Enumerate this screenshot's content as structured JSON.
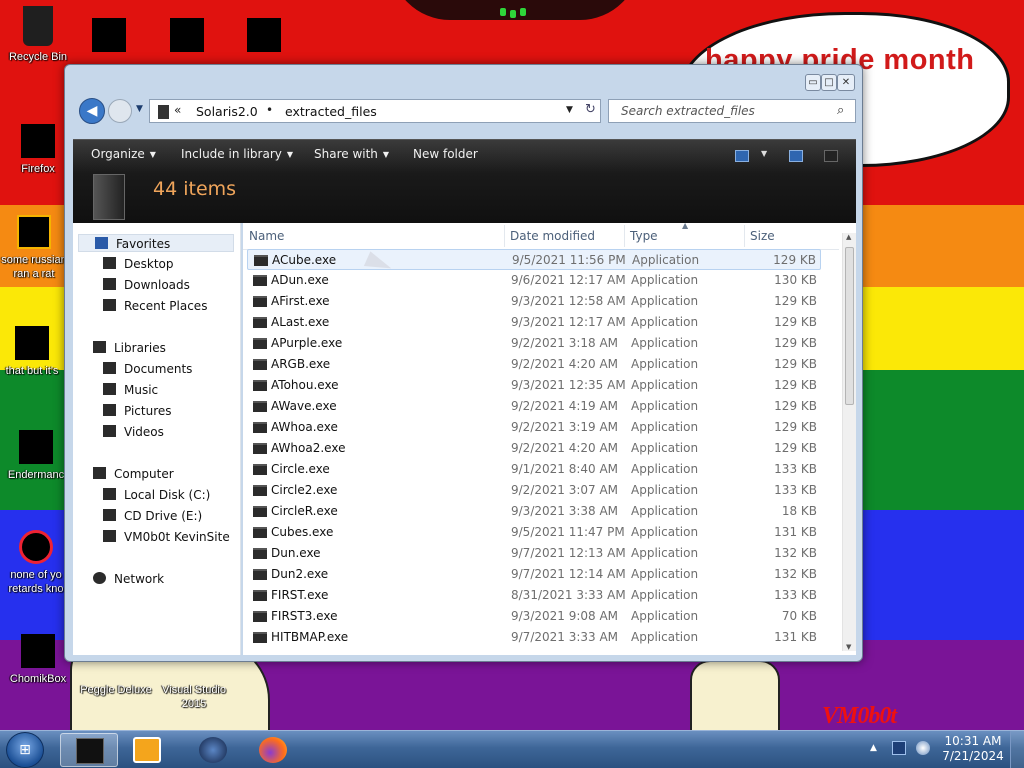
{
  "desktop": {
    "bubble_text": "happy pride month",
    "signature": "VM0b0t",
    "icons": [
      {
        "label": "Recycle Bin"
      },
      {
        "label": "Firefox"
      },
      {
        "label": "some russian ran a rat"
      },
      {
        "label": "that but it's"
      },
      {
        "label": "Endermanc"
      },
      {
        "label": "none of yo retards kno"
      },
      {
        "label": "ChomikBox"
      },
      {
        "label": "Peggle Deluxe"
      },
      {
        "label": "Visual Studio 2015"
      }
    ]
  },
  "window": {
    "controls": {
      "minimize": "▭",
      "maximize": "□",
      "close": "✕"
    },
    "address": {
      "chevron": "«",
      "crumbs": [
        "Solaris2.0",
        "extracted_files"
      ],
      "separator": "•",
      "dropdown": "▼",
      "refresh": "↻"
    },
    "search": {
      "placeholder": "Search extracted_files",
      "icon": "⌕"
    },
    "toolbar": {
      "organize": "Organize",
      "include_in_library": "Include in library",
      "share_with": "Share with",
      "new_folder": "New folder",
      "caret": "▼"
    },
    "item_count": "44 items",
    "nav": {
      "favorites": "Favorites",
      "desktop": "Desktop",
      "downloads": "Downloads",
      "recent_places": "Recent Places",
      "libraries": "Libraries",
      "documents": "Documents",
      "music": "Music",
      "pictures": "Pictures",
      "videos": "Videos",
      "computer": "Computer",
      "local_disk": "Local Disk (C:)",
      "cd_drive": "CD Drive (E:)",
      "vm0b0t": "VM0b0t KevinSite",
      "network": "Network"
    },
    "columns": {
      "name": "Name",
      "date": "Date modified",
      "type": "Type",
      "size": "Size"
    },
    "files": [
      {
        "name": "ACube.exe",
        "date": "9/5/2021 11:56 PM",
        "type": "Application",
        "size": "129 KB"
      },
      {
        "name": "ADun.exe",
        "date": "9/6/2021 12:17 AM",
        "type": "Application",
        "size": "130 KB"
      },
      {
        "name": "AFirst.exe",
        "date": "9/3/2021 12:58 AM",
        "type": "Application",
        "size": "129 KB"
      },
      {
        "name": "ALast.exe",
        "date": "9/3/2021 12:17 AM",
        "type": "Application",
        "size": "129 KB"
      },
      {
        "name": "APurple.exe",
        "date": "9/2/2021 3:18 AM",
        "type": "Application",
        "size": "129 KB"
      },
      {
        "name": "ARGB.exe",
        "date": "9/2/2021 4:20 AM",
        "type": "Application",
        "size": "129 KB"
      },
      {
        "name": "ATohou.exe",
        "date": "9/3/2021 12:35 AM",
        "type": "Application",
        "size": "129 KB"
      },
      {
        "name": "AWave.exe",
        "date": "9/2/2021 4:19 AM",
        "type": "Application",
        "size": "129 KB"
      },
      {
        "name": "AWhoa.exe",
        "date": "9/2/2021 3:19 AM",
        "type": "Application",
        "size": "129 KB"
      },
      {
        "name": "AWhoa2.exe",
        "date": "9/2/2021 4:20 AM",
        "type": "Application",
        "size": "129 KB"
      },
      {
        "name": "Circle.exe",
        "date": "9/1/2021 8:40 AM",
        "type": "Application",
        "size": "133 KB"
      },
      {
        "name": "Circle2.exe",
        "date": "9/2/2021 3:07 AM",
        "type": "Application",
        "size": "133 KB"
      },
      {
        "name": "CircleR.exe",
        "date": "9/3/2021 3:38 AM",
        "type": "Application",
        "size": "18 KB"
      },
      {
        "name": "Cubes.exe",
        "date": "9/5/2021 11:47 PM",
        "type": "Application",
        "size": "131 KB"
      },
      {
        "name": "Dun.exe",
        "date": "9/7/2021 12:13 AM",
        "type": "Application",
        "size": "132 KB"
      },
      {
        "name": "Dun2.exe",
        "date": "9/7/2021 12:14 AM",
        "type": "Application",
        "size": "132 KB"
      },
      {
        "name": "FIRST.exe",
        "date": "8/31/2021 3:33 AM",
        "type": "Application",
        "size": "133 KB"
      },
      {
        "name": "FIRST3.exe",
        "date": "9/3/2021 9:08 AM",
        "type": "Application",
        "size": "70 KB"
      },
      {
        "name": "HITBMAP.exe",
        "date": "9/7/2021 3:33 AM",
        "type": "Application",
        "size": "131 KB"
      }
    ]
  },
  "taskbar": {
    "start_glyph": "⊞",
    "tray_arrow": "▲",
    "time": "10:31 AM",
    "date": "7/21/2024"
  }
}
